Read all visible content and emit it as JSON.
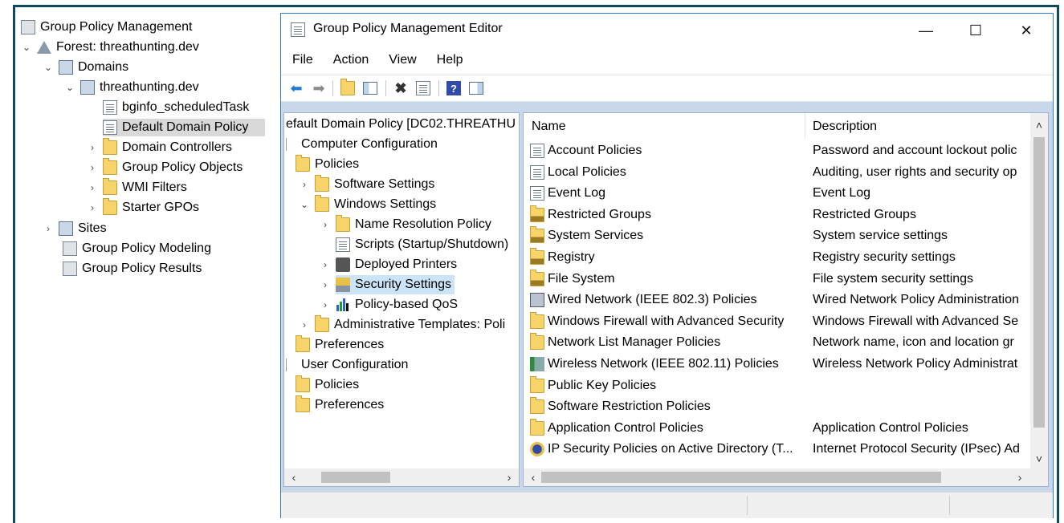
{
  "gpmc": {
    "title": "Group Policy Management",
    "forest": "Forest: threathunting.dev",
    "domains": "Domains",
    "domain": "threathunting.dev",
    "gpo_bginfo": "bginfo_scheduledTask",
    "gpo_default": "Default Domain Policy",
    "domain_controllers": "Domain Controllers",
    "group_policy_objects": "Group Policy Objects",
    "wmi_filters": "WMI Filters",
    "starter_gpos": "Starter GPOs",
    "sites": "Sites",
    "modeling": "Group Policy Modeling",
    "results": "Group Policy Results"
  },
  "editor": {
    "title": "Group Policy Management Editor",
    "minimize": "—",
    "maximize": "☐",
    "close": "✕",
    "menu": [
      "File",
      "Action",
      "View",
      "Help"
    ],
    "tree": {
      "root": "efault Domain Policy [DC02.THREATHU",
      "computer_config": "Computer Configuration",
      "policies": "Policies",
      "software_settings": "Software Settings",
      "windows_settings": "Windows Settings",
      "name_resolution": "Name Resolution Policy",
      "scripts": "Scripts (Startup/Shutdown)",
      "deployed_printers": "Deployed Printers",
      "security_settings": "Security Settings",
      "policy_qos": "Policy-based QoS",
      "admin_templates": "Administrative Templates: Poli",
      "preferences": "Preferences",
      "user_config": "User Configuration",
      "user_policies": "Policies",
      "user_preferences": "Preferences"
    },
    "list": {
      "col_name": "Name",
      "col_desc": "Description",
      "rows": [
        {
          "name": "Account Policies",
          "desc": "Password and account lockout polic",
          "icon": "book-icon"
        },
        {
          "name": "Local Policies",
          "desc": "Auditing, user rights and security op",
          "icon": "book-icon"
        },
        {
          "name": "Event Log",
          "desc": "Event Log",
          "icon": "book-icon"
        },
        {
          "name": "Restricted Groups",
          "desc": "Restricted Groups",
          "icon": "locked-folder-icon"
        },
        {
          "name": "System Services",
          "desc": "System service settings",
          "icon": "locked-folder-icon"
        },
        {
          "name": "Registry",
          "desc": "Registry security settings",
          "icon": "locked-folder-icon"
        },
        {
          "name": "File System",
          "desc": "File system security settings",
          "icon": "locked-folder-icon"
        },
        {
          "name": "Wired Network (IEEE 802.3) Policies",
          "desc": "Wired Network Policy Administration",
          "icon": "wired-network-icon"
        },
        {
          "name": "Windows Firewall with Advanced Security",
          "desc": "Windows Firewall with Advanced Se",
          "icon": "folder-icon"
        },
        {
          "name": "Network List Manager Policies",
          "desc": "Network name, icon and location gr",
          "icon": "folder-icon"
        },
        {
          "name": "Wireless Network (IEEE 802.11) Policies",
          "desc": "Wireless Network Policy Administrat",
          "icon": "wireless-network-icon"
        },
        {
          "name": "Public Key Policies",
          "desc": "",
          "icon": "folder-icon"
        },
        {
          "name": "Software Restriction Policies",
          "desc": "",
          "icon": "folder-icon"
        },
        {
          "name": "Application Control Policies",
          "desc": "Application Control Policies",
          "icon": "folder-icon"
        },
        {
          "name": "IP Security Policies on Active Directory (T...",
          "desc": "Internet Protocol Security (IPsec) Ad",
          "icon": "ipsec-icon"
        }
      ]
    }
  },
  "colors": {
    "frame": "#0e4a5a",
    "window_border": "#2b78c5",
    "selection": "#cce4f7",
    "folder": "#f6d46a"
  }
}
